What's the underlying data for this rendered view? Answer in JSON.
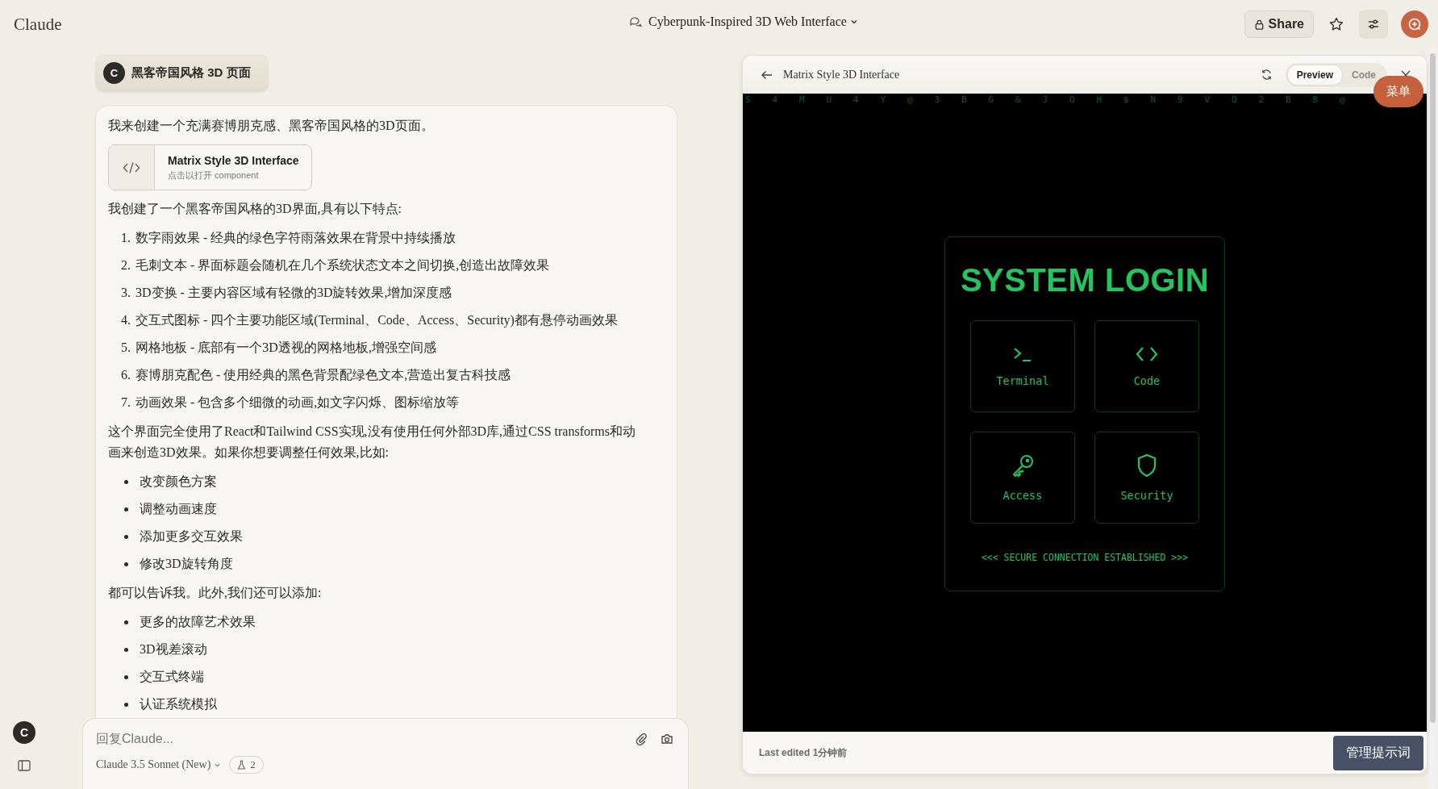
{
  "app": {
    "name": "Claude"
  },
  "header": {
    "title": "Cyberpunk-Inspired 3D Web Interface",
    "share": "Share"
  },
  "user_message": {
    "avatar": "C",
    "text": "黑客帝国风格 3D 页面"
  },
  "response": {
    "intro": "我来创建一个充满赛博朋克感、黑客帝国风格的3D页面。",
    "artifact": {
      "title": "Matrix Style 3D Interface",
      "subtitle": "点击以打开 component"
    },
    "lead": "我创建了一个黑客帝国风格的3D界面,具有以下特点:",
    "features": [
      {
        "number": "1.",
        "text": "数字雨效果 - 经典的绿色字符雨落效果在背景中持续播放"
      },
      {
        "number": "2.",
        "text": "毛刺文本 - 界面标题会随机在几个系统状态文本之间切换,创造出故障效果"
      },
      {
        "number": "3.",
        "text": "3D变换 - 主要内容区域有轻微的3D旋转效果,增加深度感"
      },
      {
        "number": "4.",
        "text": "交互式图标 - 四个主要功能区域(Terminal、Code、Access、Security)都有悬停动画效果"
      },
      {
        "number": "5.",
        "text": "网格地板 - 底部有一个3D透视的网格地板,增强空间感"
      },
      {
        "number": "6.",
        "text": "赛博朋克配色 - 使用经典的黑色背景配绿色文本,营造出复古科技感"
      },
      {
        "number": "7.",
        "text": "动画效果 - 包含多个细微的动画,如文字闪烁、图标缩放等"
      }
    ],
    "paragraph": "这个界面完全使用了React和Tailwind CSS实现,没有使用任何外部3D库,通过CSS transforms和动画来创造3D效果。如果你想要调整任何效果,比如:",
    "suggestions": [
      "改变颜色方案",
      "调整动画速度",
      "添加更多交互效果",
      "修改3D旋转角度"
    ],
    "paragraph_2": "都可以告诉我。此外,我们还可以添加:",
    "additions": [
      "更多的故障艺术效果",
      "3D视差滚动",
      "交互式终端",
      "认证系统模拟"
    ]
  },
  "composer": {
    "placeholder": "回复Claude...",
    "model": "Claude 3.5 Sonnet (New)",
    "count": "2"
  },
  "sidebar": {
    "avatar": "C"
  },
  "preview": {
    "title": "Matrix Style 3D Interface",
    "tabs": [
      {
        "label": "Preview",
        "selected": true
      },
      {
        "label": "Code",
        "selected": false
      }
    ],
    "rain": [
      "S",
      "4",
      "M",
      "U",
      "4",
      "Y",
      "@",
      "3",
      "B",
      "G",
      "&",
      "J",
      "Q",
      "H",
      "$",
      "N",
      "9",
      "V",
      "Q",
      "2",
      "B",
      "B",
      "@"
    ],
    "login": {
      "title": "SYSTEM LOGIN",
      "tiles": [
        {
          "label": "Terminal",
          "kind": "terminal"
        },
        {
          "label": "Code",
          "kind": "code"
        },
        {
          "label": "Access",
          "kind": "key"
        },
        {
          "label": "Security",
          "kind": "shield"
        }
      ],
      "status": "<<< SECURE CONNECTION ESTABLISHED >>>"
    },
    "footer": "Last edited 1分钟前",
    "manage_button": "管理提示词"
  },
  "menu_button": "菜单"
}
